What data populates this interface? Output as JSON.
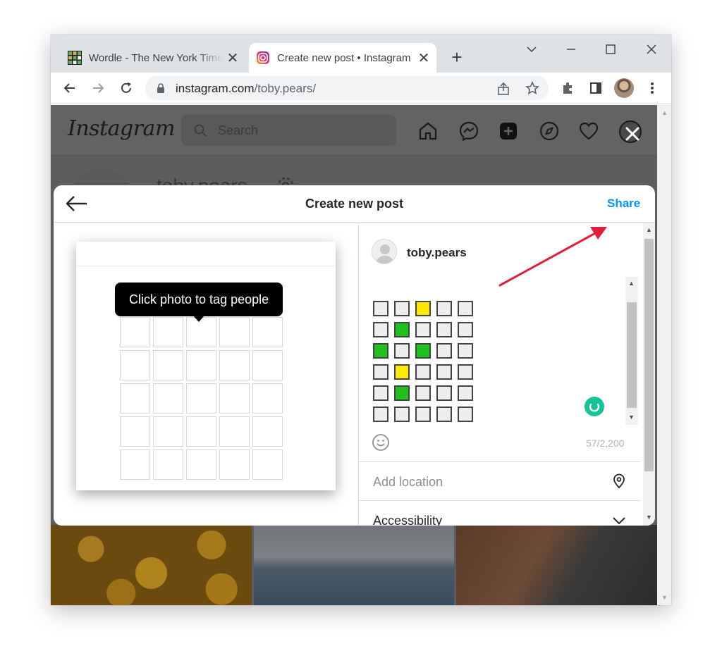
{
  "browser": {
    "tabs": [
      {
        "title": "Wordle - The New York Times",
        "active": false,
        "close": "✕"
      },
      {
        "title": "Create new post • Instagram",
        "active": true,
        "close": "✕"
      }
    ],
    "new_tab": "+",
    "url": {
      "domain": "instagram.com",
      "path": "/toby.pears/"
    },
    "icons": [
      "back-icon",
      "forward-icon",
      "reload-icon",
      "lock-icon",
      "share-icon",
      "star-icon",
      "extensions-icon",
      "side-panel-icon",
      "profile-avatar",
      "menu-icon",
      "minimize-icon",
      "maximize-icon",
      "close-icon",
      "tab-search-icon"
    ]
  },
  "instagram": {
    "logo": "Instagram",
    "search_placeholder": "Search",
    "profile_username": "toby.pears",
    "nav_icons": [
      "home-icon",
      "messenger-icon",
      "new-post-icon",
      "explore-icon",
      "heart-icon",
      "profile-avatar"
    ]
  },
  "modal": {
    "title": "Create new post",
    "share_label": "Share",
    "tooltip": "Click photo to tag people",
    "username": "toby.pears",
    "char_count": "57/2,200",
    "location_label": "Add location",
    "accessibility_label": "Accessibility",
    "wordle_grid": [
      [
        "empty",
        "empty",
        "yellow",
        "empty",
        "empty"
      ],
      [
        "empty",
        "green",
        "empty",
        "empty",
        "empty"
      ],
      [
        "green",
        "empty",
        "green",
        "empty",
        "empty"
      ],
      [
        "empty",
        "yellow",
        "empty",
        "empty",
        "empty"
      ],
      [
        "empty",
        "green",
        "empty",
        "empty",
        "empty"
      ],
      [
        "empty",
        "empty",
        "empty",
        "empty",
        "empty"
      ]
    ]
  },
  "colors": {
    "share_blue": "#0095f6",
    "wordle_yellow": "#ffe800",
    "wordle_green": "#1ec11e",
    "annotation_red": "#e0203a",
    "grammarly_green": "#15c39a"
  }
}
